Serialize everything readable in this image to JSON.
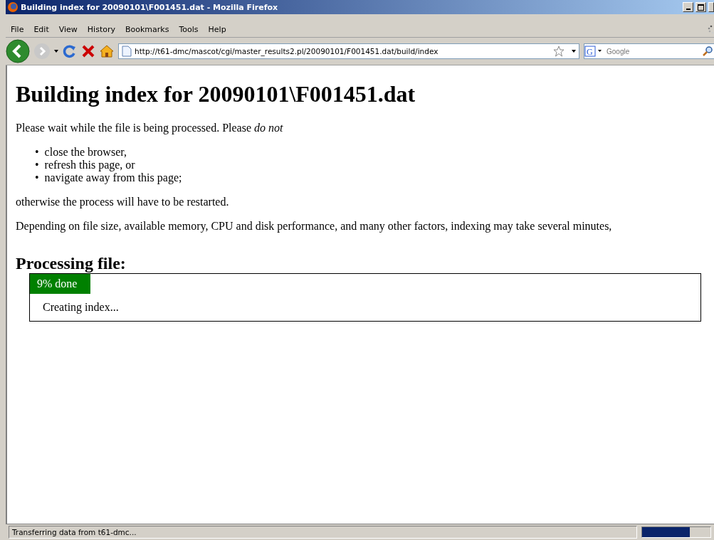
{
  "window": {
    "title": "Building index for 20090101\\F001451.dat - Mozilla Firefox"
  },
  "menu": [
    "File",
    "Edit",
    "View",
    "History",
    "Bookmarks",
    "Tools",
    "Help"
  ],
  "address": {
    "value": "http://t61-dmc/mascot/cgi/master_results2.pl/20090101/F001451.dat/build/index"
  },
  "search": {
    "engine": "G",
    "placeholder": "Google"
  },
  "page": {
    "heading": "Building index for 20090101\\F001451.dat",
    "intro": "Please wait while the file is being processed. Please *do not*",
    "bullets": [
      {
        "marker": "•",
        "text": "close the browser,"
      },
      {
        "marker": "•",
        "text": "refresh this page, or"
      },
      {
        "marker": "•",
        "text": "navigate away from this page;"
      }
    ],
    "after": "otherwise the process will have to be restarted.",
    "note": "Depending on file size, available memory, CPU and disk performance, and many other factors, indexing may take several minutes,",
    "subheading": "Processing file:",
    "progress": {
      "label": "9% done",
      "level": 0.09,
      "message": "Creating index..."
    }
  },
  "status_bar": {
    "text": "Transferring data from t61-dmc...",
    "level": 0.7
  }
}
